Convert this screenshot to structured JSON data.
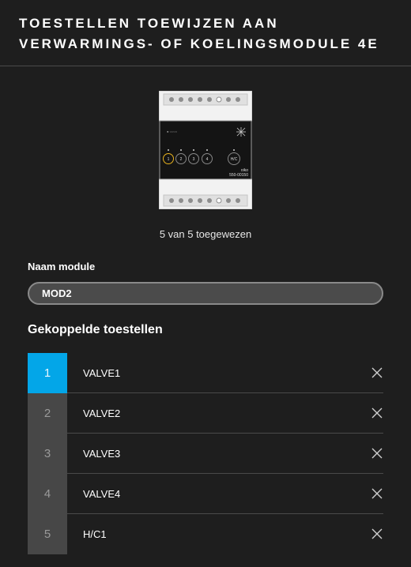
{
  "header": {
    "title": "TOESTELLEN TOEWIJZEN AAN VERWARMINGS- OF KOELINGSMODULE 4E"
  },
  "module_image": {
    "brand": "niko",
    "part_number": "550-00150",
    "buttons": [
      "1",
      "2",
      "3",
      "4",
      "H/C"
    ],
    "highlight_color": "#e8b21e"
  },
  "status": {
    "assigned_text": "5 van 5 toegewezen"
  },
  "module_name": {
    "label": "Naam module",
    "value": "MOD2"
  },
  "devices": {
    "title": "Gekoppelde toestellen",
    "items": [
      {
        "number": "1",
        "name": "VALVE1",
        "active": true
      },
      {
        "number": "2",
        "name": "VALVE2",
        "active": false
      },
      {
        "number": "3",
        "name": "VALVE3",
        "active": false
      },
      {
        "number": "4",
        "name": "VALVE4",
        "active": false
      },
      {
        "number": "5",
        "name": "H/C1",
        "active": false
      }
    ]
  },
  "colors": {
    "background": "#1e1e1e",
    "accent": "#03a6e8",
    "number_cell": "#474747"
  },
  "icons": {
    "remove": "close-icon"
  }
}
